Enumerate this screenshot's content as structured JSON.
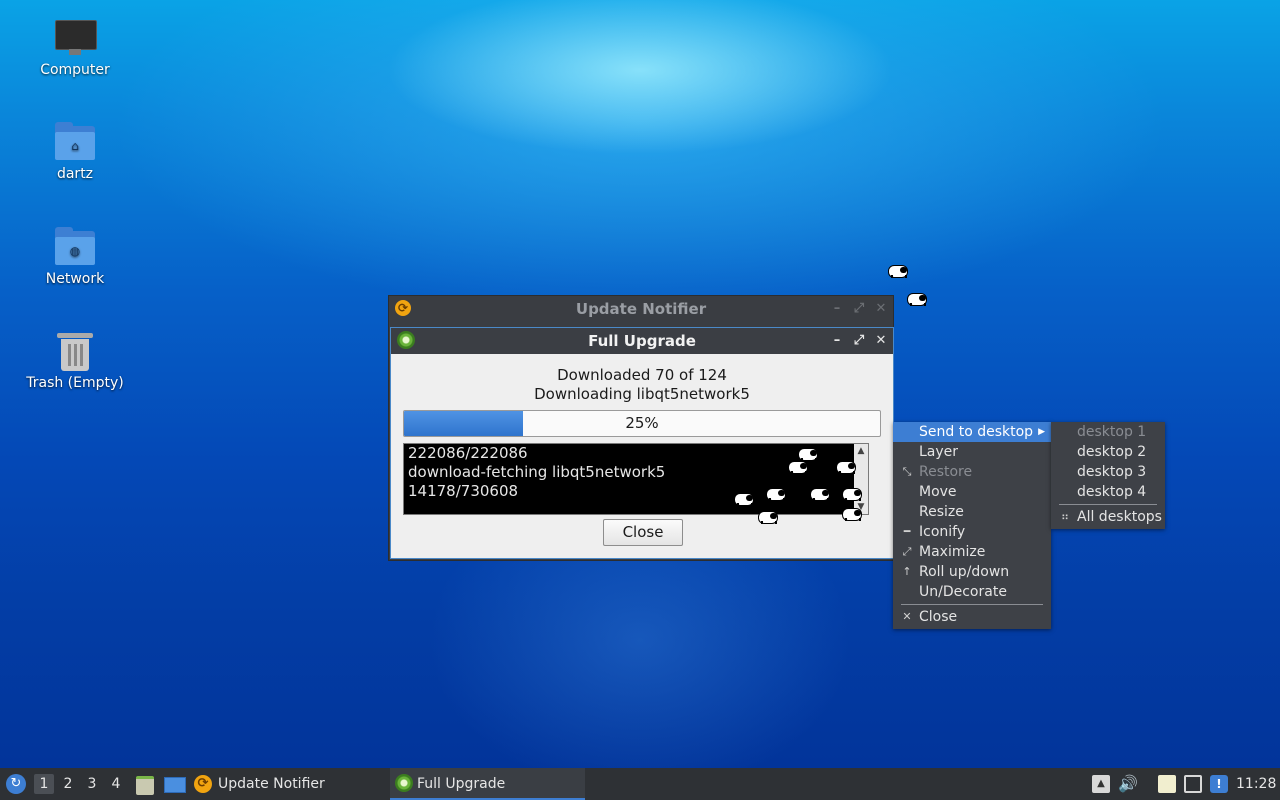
{
  "desktop": {
    "icons": [
      {
        "label": "Computer"
      },
      {
        "label": "dartz"
      },
      {
        "label": "Network"
      },
      {
        "label": "Trash (Empty)"
      }
    ]
  },
  "notifier_window": {
    "title": "Update Notifier",
    "icon": "update-notifier-icon"
  },
  "upgrade_window": {
    "title": "Full Upgrade",
    "icon": "gear-icon",
    "status_line_1": "Downloaded 70 of 124",
    "status_line_2": "Downloading libqt5network5",
    "progress": {
      "percent": 25,
      "label": "25%",
      "fill_color": "#3a82d8"
    },
    "terminal_lines": [
      "222086/222086",
      "download-fetching libqt5network5",
      "14178/730608"
    ],
    "close_label": "Close"
  },
  "context_menu": {
    "items": [
      {
        "label": "Send to desktop",
        "state": "active",
        "has_submenu": true
      },
      {
        "label": "Layer",
        "state": "normal",
        "has_submenu": true
      },
      {
        "label": "Restore",
        "state": "disabled",
        "icon": "restore-icon"
      },
      {
        "label": "Move",
        "state": "normal"
      },
      {
        "label": "Resize",
        "state": "normal"
      },
      {
        "label": "Iconify",
        "state": "normal",
        "icon": "iconify-icon"
      },
      {
        "label": "Maximize",
        "state": "normal",
        "icon": "maximize-icon"
      },
      {
        "label": "Roll up/down",
        "state": "normal",
        "icon": "rollup-icon"
      },
      {
        "label": "Un/Decorate",
        "state": "normal"
      },
      {
        "label": "Close",
        "state": "normal",
        "icon": "close-icon"
      }
    ]
  },
  "desktop_submenu": {
    "items": [
      {
        "label": "desktop 1",
        "state": "disabled"
      },
      {
        "label": "desktop 2",
        "state": "normal"
      },
      {
        "label": "desktop 3",
        "state": "normal"
      },
      {
        "label": "desktop 4",
        "state": "normal"
      },
      {
        "label": "All desktops",
        "state": "normal",
        "icon": "all-desktops-icon"
      }
    ]
  },
  "taskbar": {
    "workspaces": [
      "1",
      "2",
      "3",
      "4"
    ],
    "active_workspace": "1",
    "tasks": [
      {
        "label": "Update Notifier",
        "icon": "update-notifier-icon",
        "active": false
      },
      {
        "label": "Full Upgrade",
        "icon": "gear-icon",
        "active": true
      }
    ],
    "clock": "11:28",
    "accent": "#3d7ed3"
  }
}
